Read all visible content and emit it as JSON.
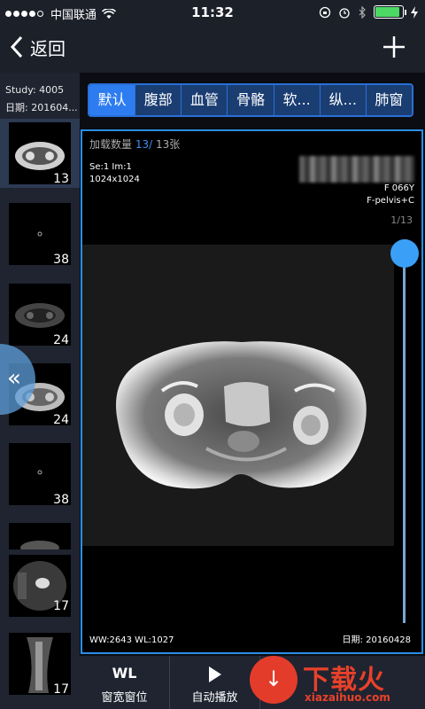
{
  "status": {
    "carrier": "中国联通",
    "time": "11:32",
    "signal_bars": 4
  },
  "nav": {
    "back_label": "返回"
  },
  "sidebar": {
    "study": "Study: 4005",
    "date": "日期: 201604...",
    "series": [
      {
        "count": "13",
        "active": true
      },
      {
        "count": "38",
        "active": false
      },
      {
        "count": "24",
        "active": false
      },
      {
        "count": "24",
        "active": false
      },
      {
        "count": "38",
        "active": false
      },
      {
        "count": "",
        "active": false
      },
      {
        "count": "17",
        "active": false
      },
      {
        "count": "17",
        "active": false
      }
    ]
  },
  "tabs": [
    "默认",
    "腹部",
    "血管",
    "骨骼",
    "软...",
    "纵...",
    "肺窗"
  ],
  "active_tab": 0,
  "viewer": {
    "load_label": "加载数量",
    "load_current": "13/",
    "load_total": "13张",
    "se_im": "Se:1  Im:1",
    "matrix": "1024x1024",
    "patient": "F  066Y",
    "protocol": "F-pelvis+C",
    "frame": "1/13",
    "ww_wl": "WW:2643  WL:1027",
    "date": "日期: 20160428",
    "slider_position": 0
  },
  "toolbar": {
    "wl_icon": "WL",
    "wl_label": "窗宽窗位",
    "play_label": "自动播放"
  },
  "watermark": {
    "text": "下载火",
    "url": "xiazaihuo.com"
  },
  "colors": {
    "accent": "#2d7df0",
    "knob": "#3aa0f7",
    "watermark": "#e8412a"
  }
}
